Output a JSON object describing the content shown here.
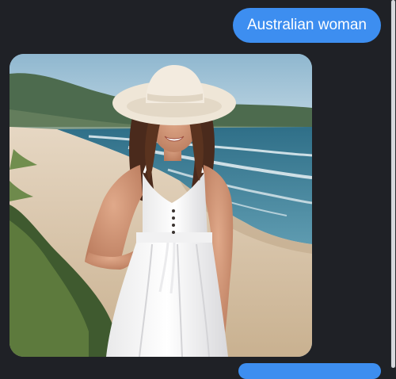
{
  "chat": {
    "messages": [
      {
        "role": "user",
        "type": "text",
        "text": "Australian woman"
      },
      {
        "role": "assistant",
        "type": "image",
        "subject": "generated-photo"
      }
    ]
  },
  "colors": {
    "background": "#1f2126",
    "user_bubble": "#3d8ef0",
    "bubble_text": "#ffffff"
  }
}
